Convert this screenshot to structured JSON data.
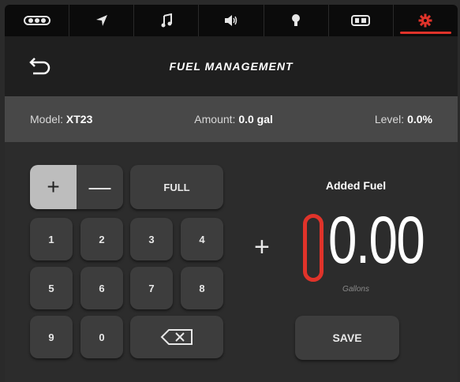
{
  "colors": {
    "accent": "#e0332a",
    "background": "#2a2a2a",
    "info_bar": "#484848",
    "key": "#3d3d3d"
  },
  "tabs": [
    {
      "icon": "vehicle-icon",
      "active": false
    },
    {
      "icon": "navigation-arrow-icon",
      "active": false
    },
    {
      "icon": "music-note-icon",
      "active": false
    },
    {
      "icon": "speaker-volume-icon",
      "active": false
    },
    {
      "icon": "light-bulb-icon",
      "active": false
    },
    {
      "icon": "battery-gauge-icon",
      "active": false
    },
    {
      "icon": "settings-gear-icon",
      "active": true
    }
  ],
  "header": {
    "title": "FUEL MANAGEMENT",
    "back_icon": "back-arrow-icon"
  },
  "info": {
    "model_label": "Model:",
    "model_value": "XT23",
    "amount_label": "Amount:",
    "amount_value": "0.0 gal",
    "level_label": "Level:",
    "level_value": "0.0%"
  },
  "keypad": {
    "plus": "+",
    "minus": "—",
    "full": "FULL",
    "keys": [
      "1",
      "2",
      "3",
      "4",
      "5",
      "6",
      "7",
      "8",
      "9",
      "0"
    ],
    "backspace_icon": "backspace-icon",
    "selected_mode": "plus"
  },
  "added_fuel": {
    "label": "Added Fuel",
    "sign": "+",
    "value": "0.00",
    "unit": "Gallons"
  },
  "save_label": "SAVE"
}
